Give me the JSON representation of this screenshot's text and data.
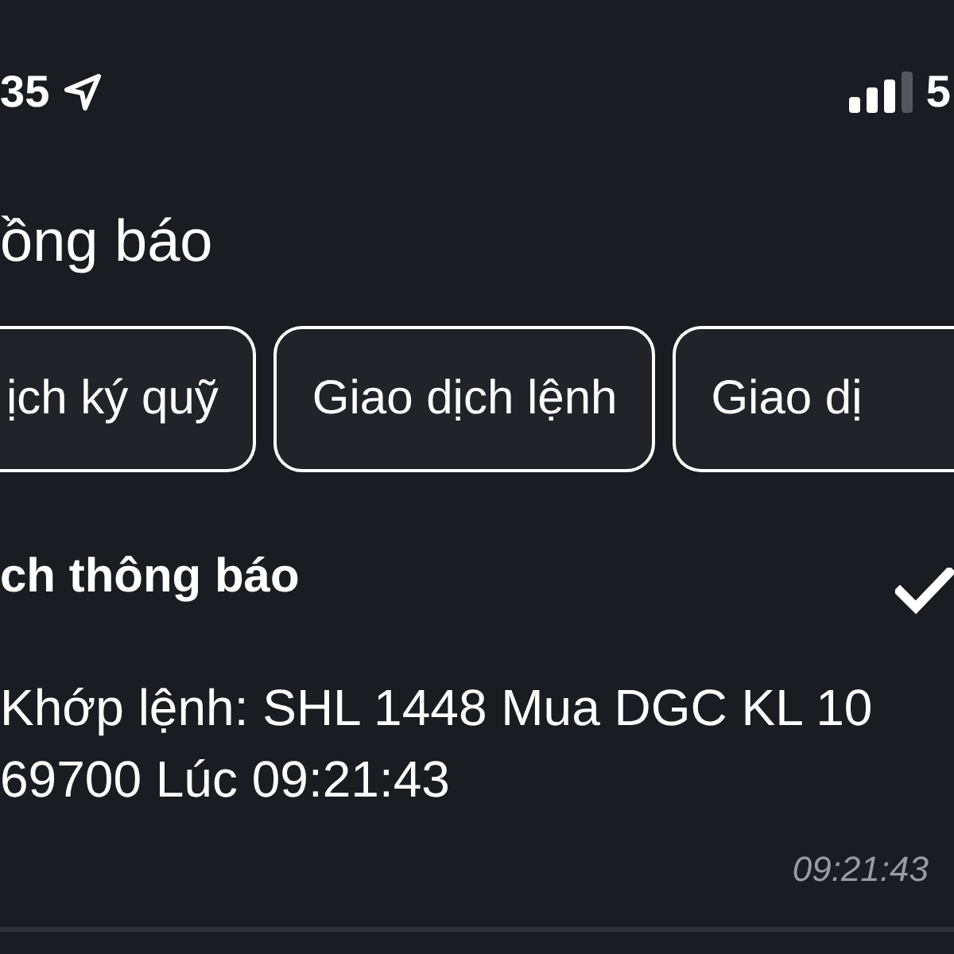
{
  "status_bar": {
    "time": "35",
    "network": "5"
  },
  "title": "ồng báo",
  "tabs": [
    {
      "label": "ịch ký quỹ",
      "selected": false
    },
    {
      "label": "Giao dịch lệnh",
      "selected": false
    },
    {
      "label": "Giao dị",
      "selected": false
    }
  ],
  "list_header": {
    "title": "ch thông báo"
  },
  "notifications": [
    {
      "lines": [
        "Khớp lệnh: SHL 1448 Mua DGC KL 10",
        "69700 Lúc 09:21:43"
      ],
      "time": "09:21:43"
    }
  ]
}
